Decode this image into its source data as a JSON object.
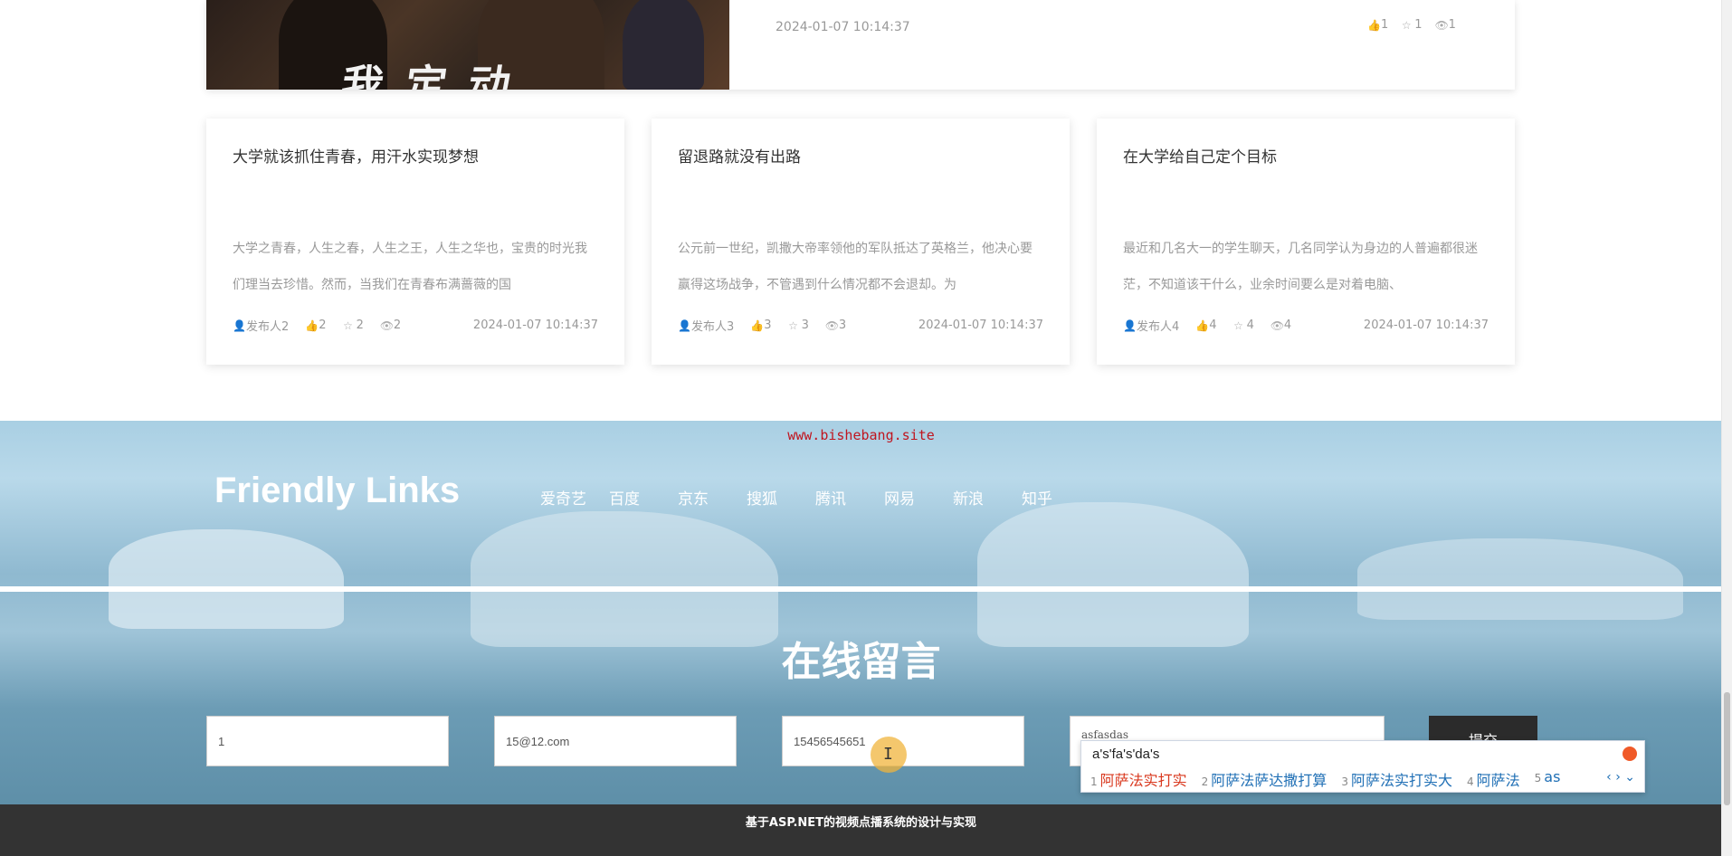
{
  "featured": {
    "poster_text": "我 定 动",
    "date": "2024-01-07 10:14:37",
    "likes": "1",
    "favorites": "1",
    "views": "1"
  },
  "cards": [
    {
      "title": "大学就该抓住青春，用汗水实现梦想",
      "excerpt": "大学之青春，人生之春，人生之王，人生之华也，宝贵的时光我们理当去珍惜。然而，当我们在青春布满蔷薇的国",
      "author": "发布人2",
      "likes": "2",
      "favorites": "2",
      "views": "2",
      "date": "2024-01-07 10:14:37"
    },
    {
      "title": "留退路就没有出路",
      "excerpt": "公元前一世纪，凯撒大帝率领他的军队抵达了英格兰，他决心要赢得这场战争，不管遇到什么情况都不会退却。为",
      "author": "发布人3",
      "likes": "3",
      "favorites": "3",
      "views": "3",
      "date": "2024-01-07 10:14:37"
    },
    {
      "title": "在大学给自己定个目标",
      "excerpt": "最近和几名大一的学生聊天，几名同学认为身边的人普遍都很迷茫，不知道该干什么，业余时间要么是对着电脑、",
      "author": "发布人4",
      "likes": "4",
      "favorites": "4",
      "views": "4",
      "date": "2024-01-07 10:14:37"
    }
  ],
  "watermark": "www.bishebang.site",
  "friendly_links": {
    "title": "Friendly Links",
    "items": [
      "爱奇艺",
      "百度",
      "京东",
      "搜狐",
      "腾讯",
      "网易",
      "新浪",
      "知乎"
    ]
  },
  "message": {
    "title": "在线留言",
    "name_value": "1",
    "email_value": "15@12.com",
    "phone_value": "15456545651",
    "content_value": "asfasdas",
    "submit_label": "提交"
  },
  "ime": {
    "input": "a's'fa's'da's",
    "candidates": [
      {
        "num": "1",
        "text": "阿萨法实打实"
      },
      {
        "num": "2",
        "text": "阿萨法萨达撒打算"
      },
      {
        "num": "3",
        "text": "阿萨法实打实大"
      },
      {
        "num": "4",
        "text": "阿萨法"
      },
      {
        "num": "5",
        "text": "as"
      }
    ],
    "nav": "‹ › ⌄"
  },
  "footer": "基于ASP.NET的视频点播系统的设计与实现",
  "colors": {
    "watermark": "#c0151f",
    "footer_bg": "#333333",
    "ime_first": "#d9381e",
    "ime_other": "#1f6fb5"
  }
}
